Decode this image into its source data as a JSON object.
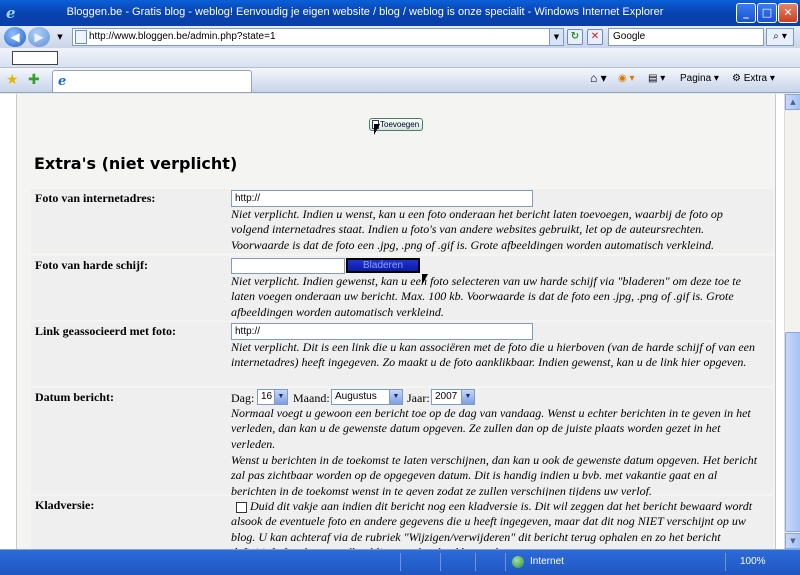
{
  "window": {
    "title": "Bloggen.be - Gratis blog - weblog! Eenvoudig je eigen website / blog / weblog is onze specialit - Windows Internet Explorer",
    "minimize": "_",
    "maximize": "□",
    "close": "✕"
  },
  "address": {
    "url": "http://www.bloggen.be/admin.php?state=1",
    "search_placeholder": "Google"
  },
  "commands": {
    "page_label": "Pagina",
    "extra_label": "Extra"
  },
  "content": {
    "add_button": "Toevoegen",
    "heading": "Extra's (niet verplicht)",
    "photo_url": {
      "label": "Foto van internetadres:",
      "value": "http://",
      "help": "Niet verplicht. Indien u wenst, kan u een foto onderaan het bericht laten toevoegen, waarbij de foto op volgend internetadres staat. Indien u foto's van andere websites gebruikt, let op de auteursrechten. Voorwaarde is dat de foto een .jpg, .png of .gif is. Grote afbeeldingen worden automatisch verkleind."
    },
    "photo_disk": {
      "label": "Foto van harde schijf:",
      "browse_button": "Bladeren",
      "help": "Niet verplicht. Indien gewenst, kan u een foto selecteren van uw harde schijf via \"bladeren\" om deze toe te laten voegen onderaan uw bericht. Max. 100 kb. Voorwaarde is dat de foto een .jpg, .png of .gif is. Grote afbeeldingen worden automatisch verkleind."
    },
    "photo_link": {
      "label": "Link geassocieerd met foto:",
      "value": "http://",
      "help": "Niet verplicht. Dit is een link die u kan associëren met de foto die u hierboven (van de harde schijf of van een internetadres) heeft ingegeven. Zo maakt u de foto aanklikbaar. Indien gewenst, kan u de link hier opgeven."
    },
    "date": {
      "label": "Datum bericht:",
      "day_label": "Dag:",
      "day_value": "16",
      "month_label": "Maand:",
      "month_value": "Augustus",
      "year_label": "Jaar:",
      "year_value": "2007",
      "help1": "Normaal voegt u gewoon een bericht toe op de dag van vandaag. Wenst u echter berichten in te geven in het verleden, dan kan u de gewenste datum opgeven. Ze zullen dan op de juiste plaats worden gezet in het verleden.",
      "help2": "Wenst u berichten in de toekomst te laten verschijnen, dan kan u ook de gewenste datum opgeven. Het bericht zal pas zichtbaar worden op de opgegeven datum. Dit is handig indien u bvb. met vakantie gaat en al berichten in de toekomst wenst in te geven zodat ze zullen verschijnen tijdens uw verlof."
    },
    "draft": {
      "label": "Kladversie:",
      "help": "Duid dit vakje aan indien dit bericht nog een kladversie is. Dit wil zeggen dat het bericht bewaard wordt alsook de eventuele foto en andere gegevens die u heeft ingegeven, maar dat dit nog NIET verschijnt op uw blog. U kan achteraf via de rubriek \"Wijzigen/verwijderen\" dit bericht terug ophalen en zo het bericht definitief afwerken en wél publiceren als u het klaar acht."
    }
  },
  "status": {
    "zone": "Internet",
    "zoom": "100%"
  },
  "icons": {
    "ie": "ie-logo-icon",
    "back": "back-arrow-icon",
    "forward": "forward-arrow-icon",
    "refresh": "refresh-icon",
    "stop": "stop-icon",
    "search": "magnifier-icon",
    "favorites": "star-icon",
    "add_favorites": "add-star-icon",
    "home": "home-icon",
    "feeds": "rss-icon",
    "print": "printer-icon",
    "tools": "gear-icon"
  }
}
